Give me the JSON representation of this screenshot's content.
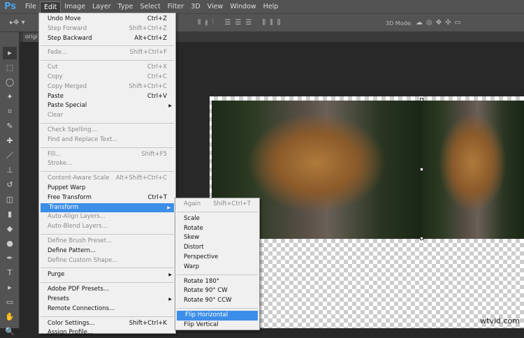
{
  "app": {
    "logo": "Ps"
  },
  "menubar": [
    "File",
    "Edit",
    "Image",
    "Layer",
    "Type",
    "Select",
    "Filter",
    "3D",
    "View",
    "Window",
    "Help"
  ],
  "options": {
    "mode_label": "3D Mode:"
  },
  "document_tab": "origi",
  "edit_menu": [
    {
      "label": "Undo Move",
      "shortcut": "Ctrl+Z"
    },
    {
      "label": "Step Forward",
      "shortcut": "Shift+Ctrl+Z",
      "disabled": true
    },
    {
      "label": "Step Backward",
      "shortcut": "Alt+Ctrl+Z"
    },
    {
      "sep": true
    },
    {
      "label": "Fade...",
      "shortcut": "Shift+Ctrl+F",
      "disabled": true
    },
    {
      "sep": true
    },
    {
      "label": "Cut",
      "shortcut": "Ctrl+X",
      "disabled": true
    },
    {
      "label": "Copy",
      "shortcut": "Ctrl+C",
      "disabled": true
    },
    {
      "label": "Copy Merged",
      "shortcut": "Shift+Ctrl+C",
      "disabled": true
    },
    {
      "label": "Paste",
      "shortcut": "Ctrl+V"
    },
    {
      "label": "Paste Special",
      "submenu": true
    },
    {
      "label": "Clear",
      "disabled": true
    },
    {
      "sep": true
    },
    {
      "label": "Check Spelling...",
      "disabled": true
    },
    {
      "label": "Find and Replace Text...",
      "disabled": true
    },
    {
      "sep": true
    },
    {
      "label": "Fill...",
      "shortcut": "Shift+F5",
      "disabled": true
    },
    {
      "label": "Stroke...",
      "disabled": true
    },
    {
      "sep": true
    },
    {
      "label": "Content-Aware Scale",
      "shortcut": "Alt+Shift+Ctrl+C",
      "disabled": true
    },
    {
      "label": "Puppet Warp"
    },
    {
      "label": "Free Transform",
      "shortcut": "Ctrl+T"
    },
    {
      "label": "Transform",
      "submenu": true,
      "highlighted": true
    },
    {
      "label": "Auto-Align Layers...",
      "disabled": true
    },
    {
      "label": "Auto-Blend Layers...",
      "disabled": true
    },
    {
      "sep": true
    },
    {
      "label": "Define Brush Preset...",
      "disabled": true
    },
    {
      "label": "Define Pattern..."
    },
    {
      "label": "Define Custom Shape...",
      "disabled": true
    },
    {
      "sep": true
    },
    {
      "label": "Purge",
      "submenu": true
    },
    {
      "sep": true
    },
    {
      "label": "Adobe PDF Presets..."
    },
    {
      "label": "Presets",
      "submenu": true
    },
    {
      "label": "Remote Connections..."
    },
    {
      "sep": true
    },
    {
      "label": "Color Settings...",
      "shortcut": "Shift+Ctrl+K"
    },
    {
      "label": "Assign Profile..."
    }
  ],
  "transform_menu": [
    {
      "label": "Again",
      "shortcut": "Shift+Ctrl+T",
      "disabled": true
    },
    {
      "sep": true
    },
    {
      "label": "Scale"
    },
    {
      "label": "Rotate"
    },
    {
      "label": "Skew"
    },
    {
      "label": "Distort"
    },
    {
      "label": "Perspective"
    },
    {
      "label": "Warp"
    },
    {
      "sep": true
    },
    {
      "label": "Rotate 180°"
    },
    {
      "label": "Rotate 90° CW"
    },
    {
      "label": "Rotate 90° CCW"
    },
    {
      "sep": true
    },
    {
      "label": "Flip Horizontal",
      "highlighted": true
    },
    {
      "label": "Flip Vertical"
    }
  ],
  "tools": [
    "move",
    "marquee",
    "lasso",
    "magic-wand",
    "crop",
    "eyedropper",
    "healing-brush",
    "brush",
    "clone-stamp",
    "history-brush",
    "eraser",
    "gradient",
    "blur",
    "dodge",
    "pen",
    "type",
    "path-selection",
    "shape",
    "hand",
    "zoom"
  ],
  "watermark": "wtvid.com"
}
